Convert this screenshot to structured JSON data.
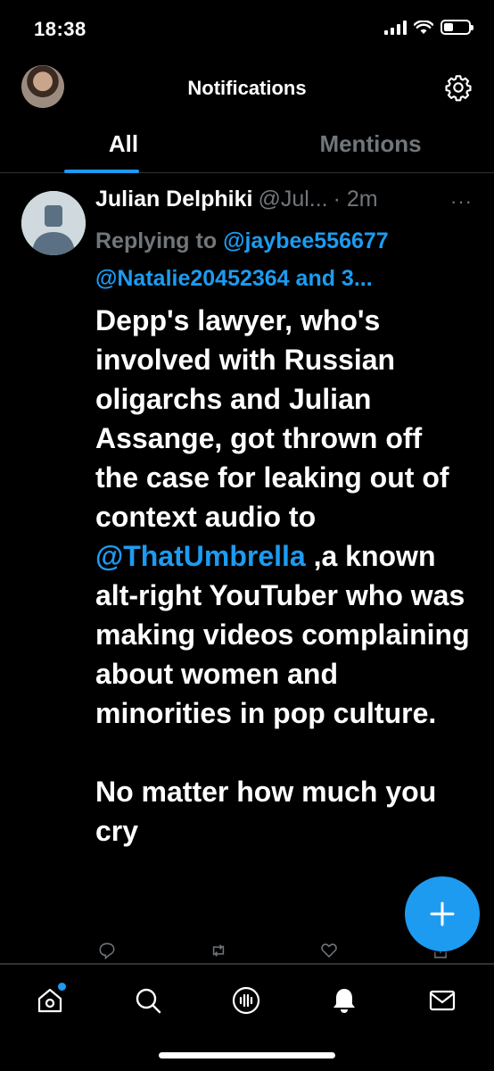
{
  "status_bar": {
    "time": "18:38"
  },
  "header": {
    "title": "Notifications"
  },
  "tabs": [
    {
      "label": "All",
      "active": true
    },
    {
      "label": "Mentions",
      "active": false
    }
  ],
  "tweet": {
    "name": "Julian Delphiki",
    "handle": "@Jul...",
    "time": "· 2m",
    "more": "···",
    "replying_prefix": "Replying to ",
    "replying_user1": "@jaybee556677",
    "replying_line2": "@Natalie20452364 and 3...",
    "text_part1": "Depp's lawyer, who's involved with Russian oligarchs and Julian Assange, got thrown off the case for leaking out of context audio to ",
    "mention": "@ThatUmbrella",
    "text_part2": " ,a known alt-right YouTuber who was making videos complaining about women and minorities in pop culture.",
    "text_part3": "No matter how much you cry"
  },
  "fab": {
    "icon": "plus-icon"
  },
  "bottom_nav": [
    {
      "name": "home-icon",
      "has_dot": true
    },
    {
      "name": "search-icon"
    },
    {
      "name": "spaces-icon"
    },
    {
      "name": "bell-icon"
    },
    {
      "name": "mail-icon"
    }
  ],
  "colors": {
    "accent": "#1d9bf0",
    "background": "#000000",
    "muted": "#71767b"
  }
}
